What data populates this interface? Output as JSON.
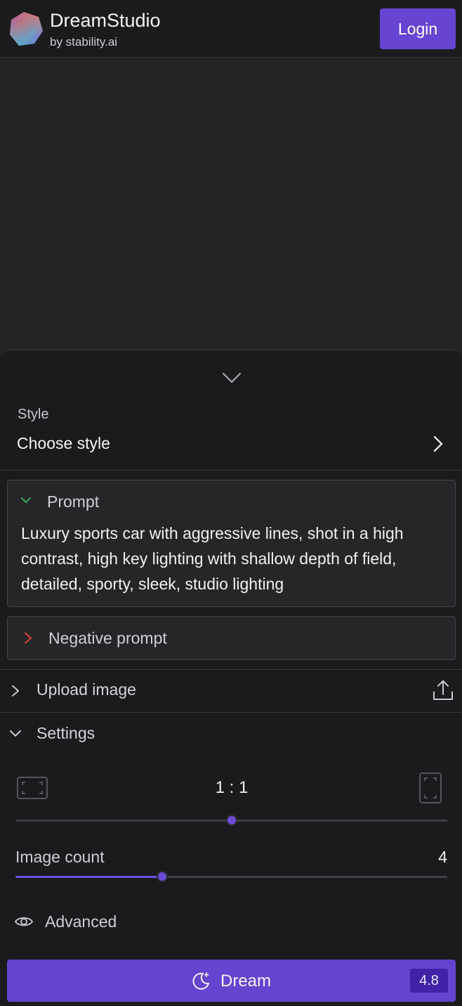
{
  "header": {
    "brand_name": "DreamStudio",
    "brand_sub": "by stability.ai",
    "login_label": "Login",
    "logo_icon": "hexagon-gradient-logo"
  },
  "panel": {
    "collapse_icon": "chevron-down-icon",
    "style": {
      "label": "Style",
      "value": "Choose style",
      "icon": "chevron-right-icon"
    },
    "prompt": {
      "title": "Prompt",
      "text": "Luxury sports car with aggressive lines, shot in a high contrast, high key lighting with shallow depth of field, detailed, sporty, sleek, studio lighting",
      "expanded": true,
      "chevron_color": "#3fa85a"
    },
    "negative_prompt": {
      "title": "Negative prompt",
      "expanded": false,
      "chevron_color": "#d9453a"
    },
    "upload": {
      "title": "Upload image",
      "icon": "upload-icon"
    },
    "settings": {
      "title": "Settings",
      "aspect_ratio": {
        "value": "1 : 1",
        "level": 0.5
      },
      "image_count": {
        "label": "Image count",
        "value": "4",
        "level": 0.34
      }
    },
    "advanced": {
      "title": "Advanced",
      "icon": "eye-icon"
    },
    "dream": {
      "label": "Dream",
      "cost": "4.8",
      "icon": "moon-stars-icon"
    }
  },
  "colors": {
    "accent": "#6744d2",
    "background": "#1b1b1e",
    "canvas": "#242427"
  }
}
